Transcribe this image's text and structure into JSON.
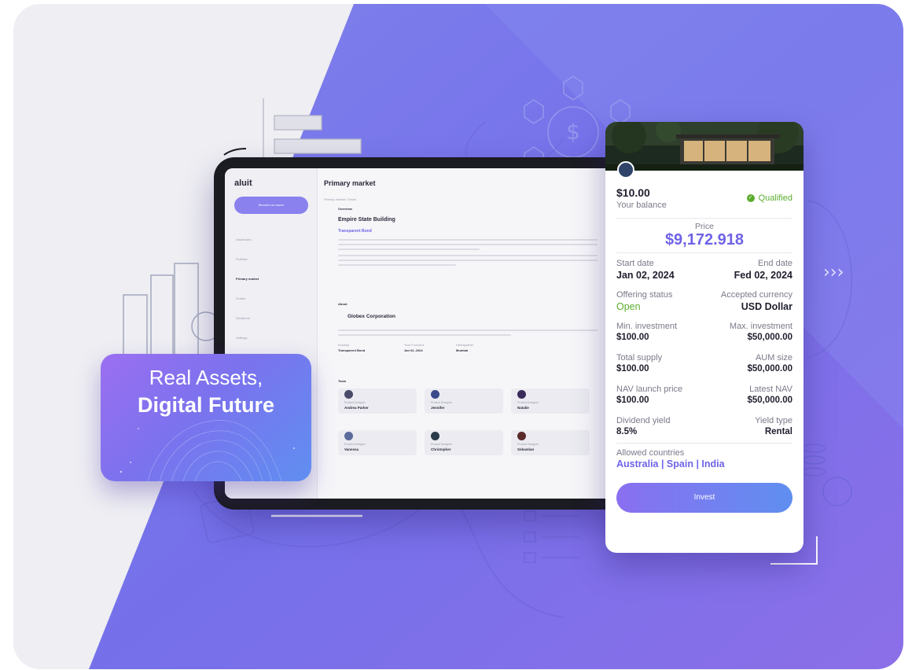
{
  "tablet": {
    "logo": "aluit",
    "issuer_button": "Become an Issuer",
    "nav": [
      {
        "label": "Dashboard"
      },
      {
        "label": "Portfolio"
      },
      {
        "label": "Primary market"
      },
      {
        "label": "Orders"
      },
      {
        "label": "Dividends"
      },
      {
        "label": "Settings"
      }
    ],
    "page_title": "Primary market",
    "breadcrumb": "Primary market / Detail",
    "overview_label": "Overview",
    "asset_name": "Empire State Building",
    "asset_tag": "Transparent Bond",
    "about_label": "About",
    "company_name": "Globex Corporation",
    "company_facts": [
      {
        "label": "Industry",
        "value": "Transparent Bond"
      },
      {
        "label": "Year Founded",
        "value": "Jan 02, 2024"
      },
      {
        "label": "Headquarter",
        "value": "Mumbai"
      }
    ],
    "team_label": "Team",
    "team": [
      {
        "role": "Product Designer",
        "name": "Andrea Parker"
      },
      {
        "role": "Product Designer",
        "name": "Jennifer"
      },
      {
        "role": "Product Designer",
        "name": "Natalie"
      },
      {
        "role": "Product Designer",
        "name": "Vanessa"
      },
      {
        "role": "Product Designer",
        "name": "Christopher"
      },
      {
        "role": "Product Designer",
        "name": "Sebastian"
      }
    ]
  },
  "promo": {
    "line1": "Real Assets,",
    "line2": "Digital Future"
  },
  "offer": {
    "balance_value": "$10.00",
    "balance_label": "Your balance",
    "qualified_label": "Qualified",
    "price_label": "Price",
    "price_value": "$9,172.918",
    "rows": [
      {
        "left_label": "Start date",
        "left_value": "Jan 02, 2024",
        "right_label": "End date",
        "right_value": "Fed 02, 2024"
      },
      {
        "left_label": "Offering status",
        "left_value": "Open",
        "right_label": "Accepted currency",
        "right_value": "USD Dollar"
      },
      {
        "left_label": "Min. investment",
        "left_value": "$100.00",
        "right_label": "Max. investment",
        "right_value": "$50,000.00"
      },
      {
        "left_label": "Total supply",
        "left_value": "$100.00",
        "right_label": "AUM size",
        "right_value": "$50,000.00"
      },
      {
        "left_label": "NAV launch price",
        "left_value": "$100.00",
        "right_label": "Latest NAV",
        "right_value": "$50,000.00"
      },
      {
        "left_label": "Dividend yield",
        "left_value": "8.5%",
        "right_label": "Yield type",
        "right_value": "Rental"
      }
    ],
    "countries_label": "Allowed countries",
    "countries_value": "Australia | Spain | India",
    "invest_button": "Invest"
  },
  "colors": {
    "accent": "#6f63e6",
    "background_purple": "#7b72ee",
    "status_green": "#5cad2f"
  }
}
